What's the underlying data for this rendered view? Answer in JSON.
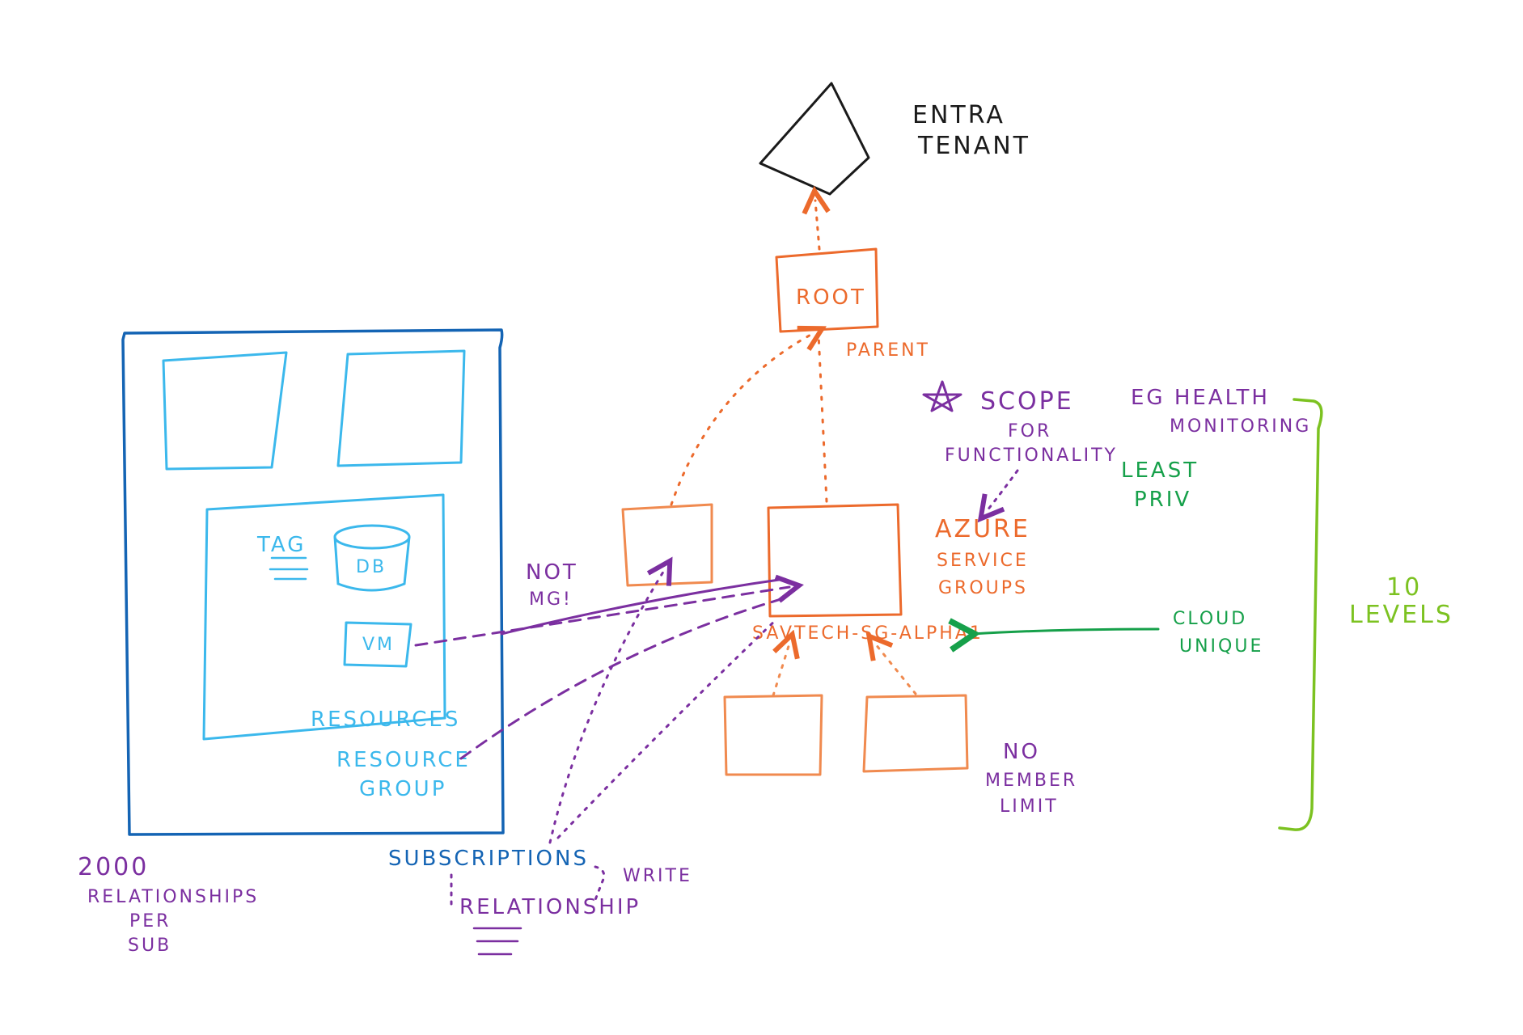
{
  "colors": {
    "black": "#1a1a1a",
    "orange": "#ec6a2c",
    "orange_light": "#f08a4f",
    "purple": "#7b2fa0",
    "blue_dark": "#1464b4",
    "blue_light": "#3bb8ec",
    "green": "#16a04a",
    "lime": "#7cc221"
  },
  "tenant": {
    "line1": "ENTRA",
    "line2": "TENANT"
  },
  "root": {
    "label": "ROOT",
    "parent_label": "PARENT"
  },
  "scope": {
    "line1": "SCOPE",
    "line2": "FOR",
    "line3": "FUNCTIONALITY",
    "example_line1": "EG HEALTH",
    "example_line2": "MONITORING",
    "least_line1": "LEAST",
    "least_line2": "PRIV"
  },
  "service_groups": {
    "line1": "AZURE",
    "line2": "SERVICE",
    "line3": "GROUPS"
  },
  "sg_name": "SAVTECH-SG-ALPHA1",
  "cloud_unique": {
    "line1": "CLOUD",
    "line2": "UNIQUE"
  },
  "levels": {
    "line1": "10",
    "line2": "LEVELS"
  },
  "no_member": {
    "line1": "NO",
    "line2": "MEMBER",
    "line3": "LIMIT"
  },
  "not_mg": {
    "line1": "NOT",
    "line2": "MG!"
  },
  "subscription": {
    "tag": "TAG",
    "db": "DB",
    "vm": "VM",
    "resources": "RESOURCES",
    "rg_line1": "RESOURCE",
    "rg_line2": "GROUP",
    "subscriptions": "SUBSCRIPTIONS"
  },
  "relationship": {
    "label": "RELATIONSHIP",
    "write": "WRITE"
  },
  "limits": {
    "count": "2000",
    "line1": "RELATIONSHIPS",
    "line2": "PER",
    "line3": "SUB"
  }
}
